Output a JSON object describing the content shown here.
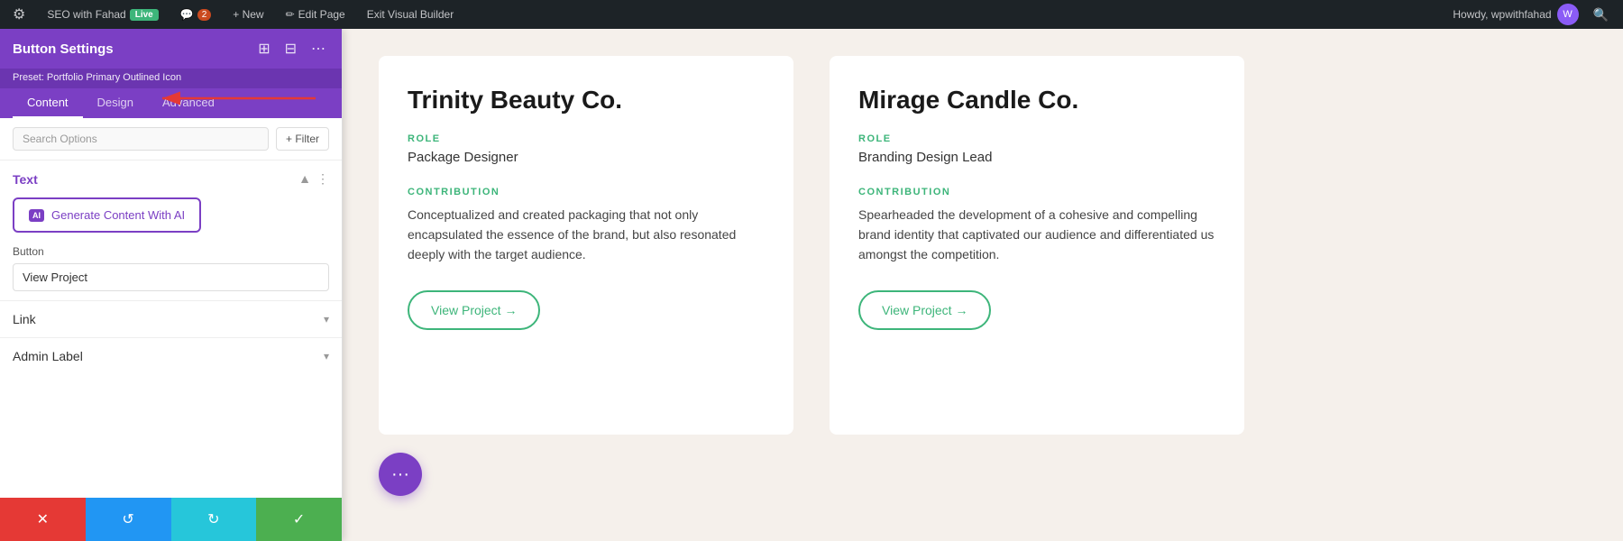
{
  "adminBar": {
    "site_name": "SEO with Fahad",
    "live_badge": "Live",
    "comments_count": "2",
    "new_label": "+ New",
    "edit_page_label": "Edit Page",
    "exit_builder_label": "Exit Visual Builder",
    "user_greeting": "Howdy, wpwithfahad"
  },
  "panel": {
    "title": "Button Settings",
    "preset_label": "Preset: Portfolio Primary Outlined Icon",
    "tabs": [
      "Content",
      "Design",
      "Advanced"
    ],
    "active_tab": "Content",
    "search_placeholder": "Search Options",
    "filter_label": "+ Filter",
    "text_section_title": "Text",
    "ai_button_label": "Generate Content With AI",
    "button_field_label": "Button",
    "button_field_value": "View Project",
    "link_section_title": "Link",
    "admin_label_section_title": "Admin Label"
  },
  "actions": {
    "delete_icon": "✕",
    "reset_icon": "↺",
    "redo_icon": "↻",
    "save_icon": "✓"
  },
  "cards": [
    {
      "company": "Trinity Beauty Co.",
      "role_label": "ROLE",
      "role_value": "Package Designer",
      "contribution_label": "CONTRIBUTION",
      "contribution_text": "Conceptualized and created packaging that not only encapsulated the essence of the brand, but also resonated deeply with the target audience.",
      "view_project_label": "View Project →"
    },
    {
      "company": "Mirage Candle Co.",
      "role_label": "ROLE",
      "role_value": "Branding Design Lead",
      "contribution_label": "CONTRIBUTION",
      "contribution_text": "Spearheaded the development of a cohesive and compelling brand identity that captivated our audience and differentiated us amongst the competition.",
      "view_project_label": "View Project →"
    }
  ],
  "fab": {
    "icon": "···"
  }
}
